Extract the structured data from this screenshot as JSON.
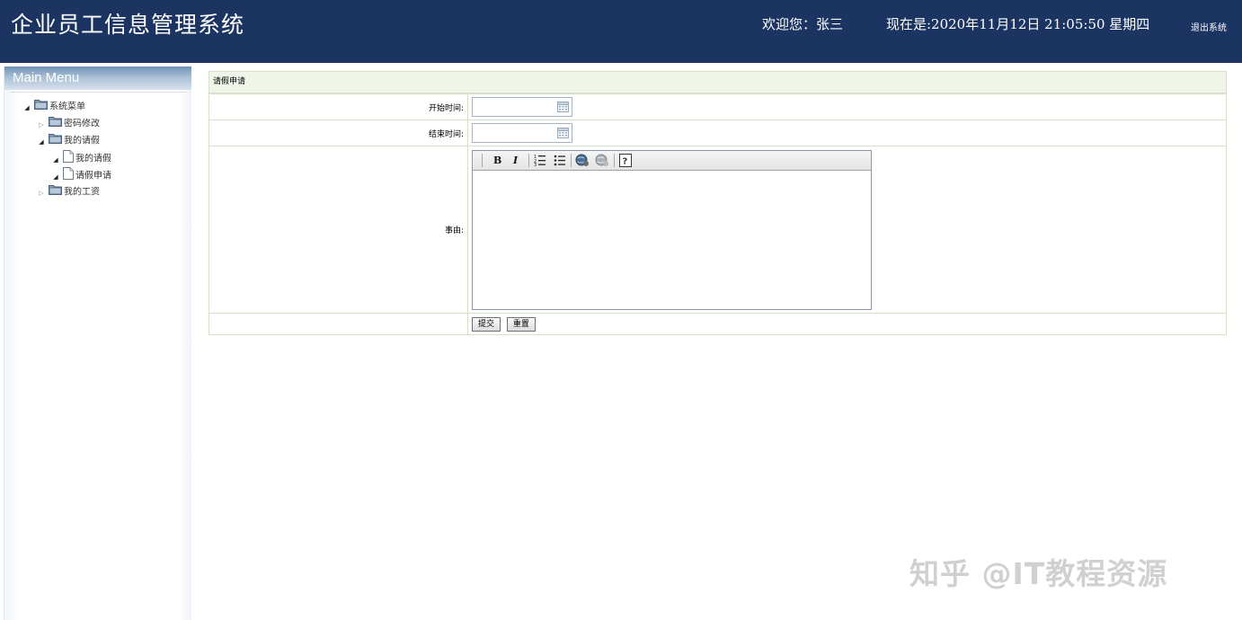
{
  "header": {
    "app_title": "企业员工信息管理系统",
    "welcome": "欢迎您：张三",
    "datetime": "现在是:2020年11月12日 21:05:50 星期四",
    "logout": "退出系统",
    "bg_color": "#1c3461"
  },
  "sidebar": {
    "title": "Main Menu",
    "tree": {
      "root": {
        "label": "系统菜单",
        "expanded": true
      },
      "items": [
        {
          "label": "密码修改",
          "expanded": false,
          "type": "folder"
        },
        {
          "label": "我的请假",
          "expanded": true,
          "type": "folder",
          "children": [
            {
              "label": "我的请假",
              "type": "page"
            },
            {
              "label": "请假申请",
              "type": "page"
            }
          ]
        },
        {
          "label": "我的工资",
          "expanded": false,
          "type": "folder"
        }
      ]
    }
  },
  "main": {
    "section_title": "请假申请",
    "form": {
      "start_label": "开始时间:",
      "start_value": "",
      "end_label": "结束时间:",
      "end_value": "",
      "reason_label": "事由:",
      "reason_value": "",
      "toolbar": {
        "bold": "B",
        "italic": "I",
        "ordered_list_icon": "ordered-list-icon",
        "unordered_list_icon": "unordered-list-icon",
        "link_icon": "link-icon",
        "unlink_icon": "unlink-icon",
        "help_icon": "help-icon"
      },
      "submit_label": "提交",
      "reset_label": "重置"
    },
    "header_bg": "#f0f5ea",
    "border_color": "#d6e0c8"
  },
  "watermark": "知乎 @IT教程资源"
}
